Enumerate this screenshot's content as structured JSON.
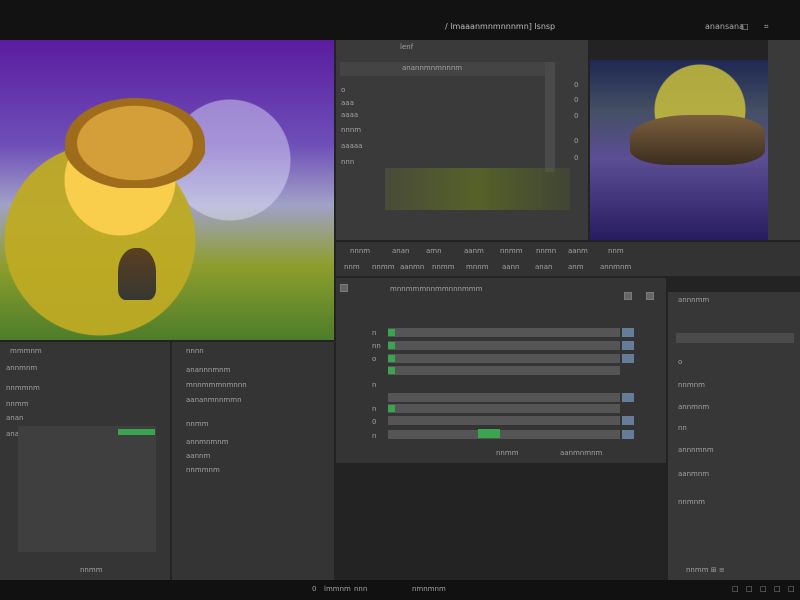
{
  "app": {
    "title": "/ lmaaanmnmnnnmn] lsnsp",
    "top_controls": [
      "anansana",
      "□",
      "⌗"
    ]
  },
  "preview_panel": {
    "title": "lenf",
    "header": "anannmnmnnnm",
    "items": [
      "o",
      "aaa",
      "aaaa",
      "nnnm",
      "aaaaa",
      "nnn"
    ],
    "right_labels": [
      "0",
      "0",
      "0",
      "0",
      "0"
    ]
  },
  "toolbar": {
    "items": [
      "nnnm",
      "anan",
      "amn",
      "aanm",
      "nnmm",
      "nnmn",
      "aanm",
      "nnm"
    ],
    "second_row": [
      "nnm",
      "nnmm",
      "aanmn",
      "nnmm",
      "mnnm",
      "aann",
      "anan",
      "anm",
      "annmnm"
    ]
  },
  "layer_panel": {
    "header": "mnnmmmnnmmnnnmmm",
    "rows": [
      {
        "label": "n",
        "accent": "green"
      },
      {
        "label": "nn",
        "accent": "green"
      },
      {
        "label": "o",
        "accent": "green"
      },
      {
        "label": "n",
        "accent": "none"
      },
      {
        "label": "n",
        "accent": "green"
      },
      {
        "label": "0",
        "accent": "blue"
      },
      {
        "label": "n",
        "accent": "blue"
      }
    ],
    "footer": [
      "nnmm",
      "aanmnmnm"
    ]
  },
  "left_panel": {
    "title": "mmmnm",
    "items": [
      "annmnm",
      "nnmmnm",
      "nnmm",
      "anan",
      "anannm"
    ],
    "footer": "nnmm"
  },
  "center_panel": {
    "title": "nnnn",
    "lines": [
      "anannnmnm",
      "mnnmmmnmnnn",
      "aananmnnmmn",
      "nnmm",
      "annmnmnm",
      "aannm",
      "nnmmnm"
    ]
  },
  "right_panel": {
    "title": "annnmm",
    "items": [
      "o",
      "nnmnm",
      "annmnm",
      "nn",
      "annnmnm",
      "aanmnm",
      "nnmnm"
    ],
    "footer": "nnmm ⊞ ≡"
  },
  "bottom_bar": {
    "items": [
      "0",
      "lmmnm",
      "nnn",
      "nmnmnm",
      "□",
      "□",
      "□",
      "□",
      "□"
    ]
  },
  "colors": {
    "accent_green": "#3ba44f",
    "accent_blue": "#657c9a",
    "panel": "#3a3a3a",
    "background": "#232323"
  }
}
